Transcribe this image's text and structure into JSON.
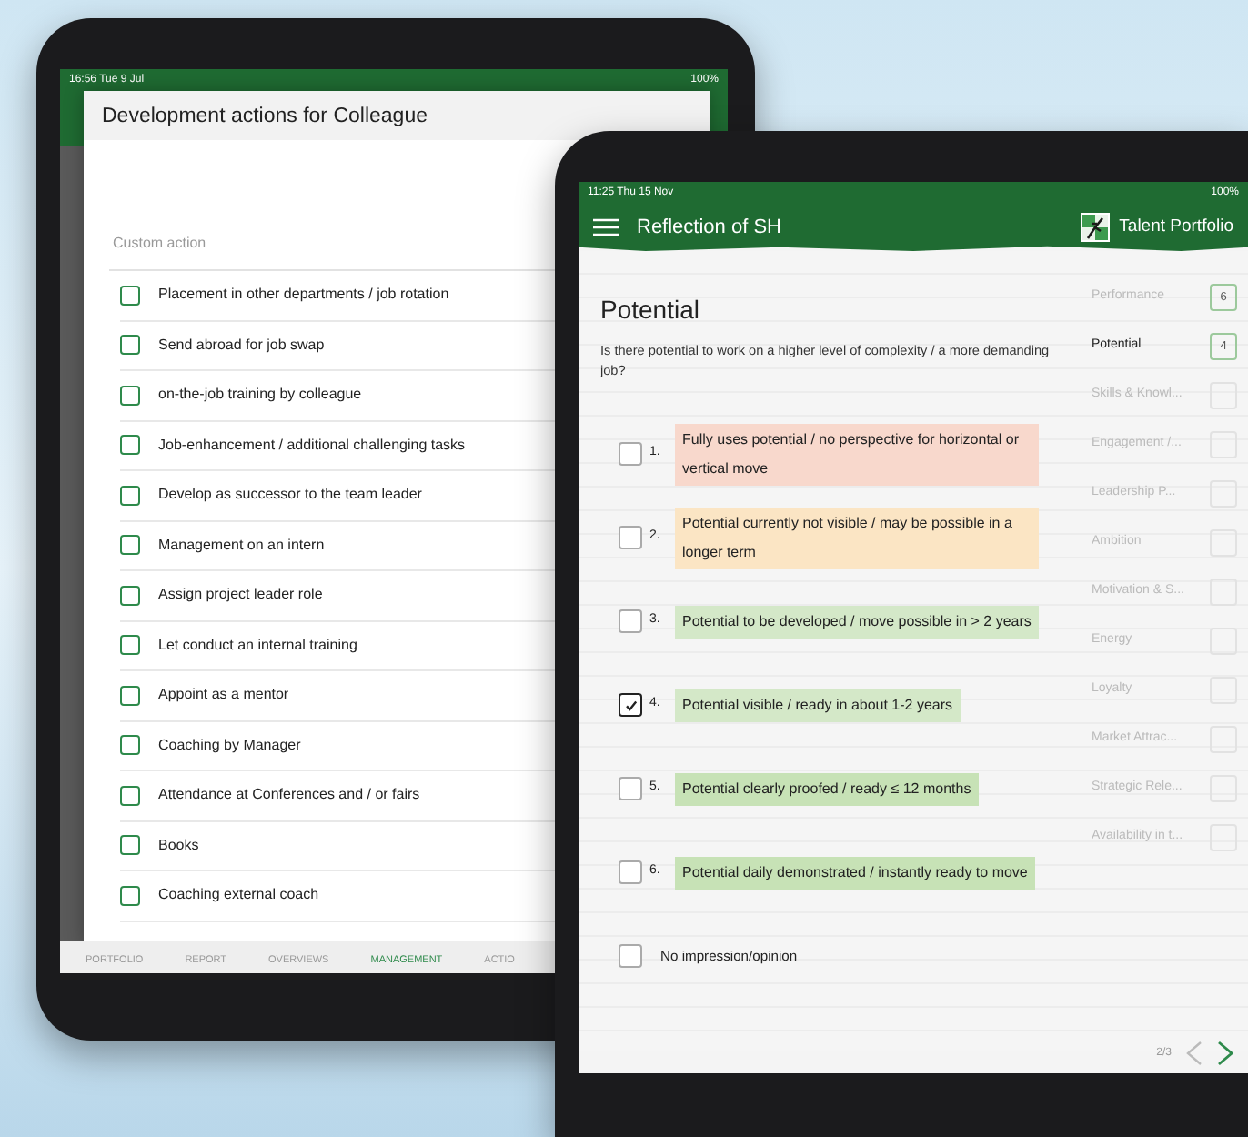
{
  "back_tablet": {
    "status_bar": {
      "time": "16:56  Tue 9 Jul",
      "battery": "100%"
    },
    "dialog": {
      "title": "Development actions for Colleague",
      "custom_action": {
        "placeholder": "Custom action"
      },
      "actions": [
        {
          "label": "Placement in other departments / job rotation",
          "checked": false
        },
        {
          "label": "Send abroad for job swap",
          "checked": false
        },
        {
          "label": "on-the-job training by colleague",
          "checked": false
        },
        {
          "label": "Job-enhancement / additional challenging tasks",
          "checked": false
        },
        {
          "label": "Develop as successor to the team leader",
          "checked": false
        },
        {
          "label": "Management on an intern",
          "checked": false
        },
        {
          "label": "Assign project leader role",
          "checked": false
        },
        {
          "label": "Let conduct an internal training",
          "checked": false
        },
        {
          "label": "Appoint as a mentor",
          "checked": false
        },
        {
          "label": "Coaching by Manager",
          "checked": false
        },
        {
          "label": "Attendance at Conferences and / or fairs",
          "checked": false
        },
        {
          "label": "Books",
          "checked": false
        },
        {
          "label": "Coaching external coach",
          "checked": false
        }
      ]
    },
    "tab_bar": [
      {
        "label": "PORTFOLIO",
        "selected": false
      },
      {
        "label": "REPORT",
        "selected": false
      },
      {
        "label": "OVERVIEWS",
        "selected": false
      },
      {
        "label": "MANAGEMENT",
        "selected": true
      },
      {
        "label": "ACTIO",
        "selected": false
      }
    ]
  },
  "front_tablet": {
    "status_bar": {
      "time": "11:25  Thu 15 Nov",
      "battery": "100%"
    },
    "header": {
      "title": "Reflection of SH",
      "brand": "Talent Portfolio"
    },
    "section": {
      "title": "Potential",
      "question": "Is there potential to work on a higher level of complexity / a more demanding job?",
      "options": [
        {
          "number": "1.",
          "label": "Fully uses potential / no perspective for horizontal or vertical move",
          "color": "#f8d8cc",
          "checked": false
        },
        {
          "number": "2.",
          "label": "Potential currently not visible / may be possible in a longer term",
          "color": "#fbe5c4",
          "checked": false
        },
        {
          "number": "3.",
          "label": "Potential to be developed / move possible in > 2 years",
          "color": "#d4e8c8",
          "checked": false
        },
        {
          "number": "4.",
          "label": "Potential visible / ready in about 1-2 years",
          "color": "#d4e8c8",
          "checked": true
        },
        {
          "number": "5.",
          "label": "Potential clearly proofed / ready ≤ 12 months",
          "color": "#c7e2b6",
          "checked": false
        },
        {
          "number": "6.",
          "label": "Potential daily demonstrated / instantly ready to move",
          "color": "#c7e2b6",
          "checked": false
        }
      ],
      "no_opinion": {
        "label": "No impression/opinion",
        "checked": false
      }
    },
    "categories": [
      {
        "label": "Performance",
        "score": "6",
        "selected": false
      },
      {
        "label": "Potential",
        "score": "4",
        "selected": true
      },
      {
        "label": "Skills & Knowl...",
        "selected": false
      },
      {
        "label": "Engagement /...",
        "selected": false
      },
      {
        "label": "Leadership P...",
        "selected": false
      },
      {
        "label": "Ambition",
        "selected": false
      },
      {
        "label": "Motivation & S...",
        "selected": false
      },
      {
        "label": "Energy",
        "selected": false
      },
      {
        "label": "Loyalty",
        "selected": false
      },
      {
        "label": "Market Attrac...",
        "selected": false
      },
      {
        "label": "Strategic Rele...",
        "selected": false
      },
      {
        "label": "Availability in t...",
        "selected": false
      }
    ],
    "pager": {
      "page": "2/3"
    }
  }
}
